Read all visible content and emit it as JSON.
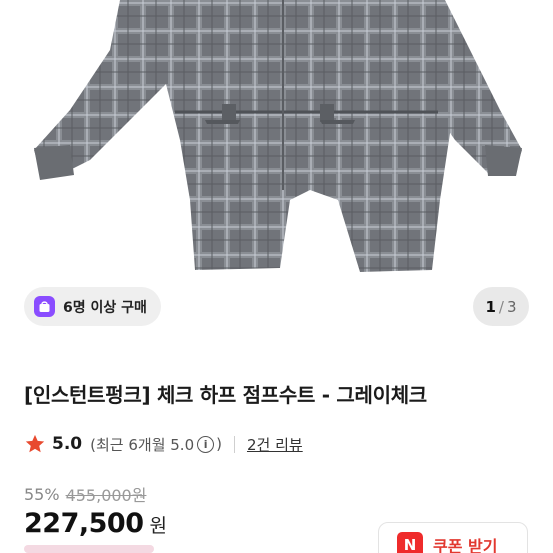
{
  "product_image": {
    "alt": "체크 하프 점프수트 그레이",
    "pattern_color": "#6f7277",
    "line_color": "#c7cdd6"
  },
  "purchase_chip": {
    "label": "6명 이상 구매",
    "icon": "shopping-bag-icon",
    "accent": "#8a4dff"
  },
  "pager": {
    "current": "1",
    "separator": "/",
    "total": "3"
  },
  "product": {
    "title": "[인스턴트펑크] 체크 하프 점프수트 - 그레이체크",
    "rating": {
      "score": "5.0",
      "recent_text": "(최근 6개월 5.0",
      "info_icon": "ⓘ",
      "close_paren": ")",
      "review_link": "2건 리뷰",
      "star_color": "#e84a2f"
    },
    "discount_rate": "55%",
    "original_price": "455,000원",
    "price": "227,500",
    "price_unit": "원"
  },
  "coupon": {
    "icon": "N",
    "label": "쿠폰 받기"
  }
}
